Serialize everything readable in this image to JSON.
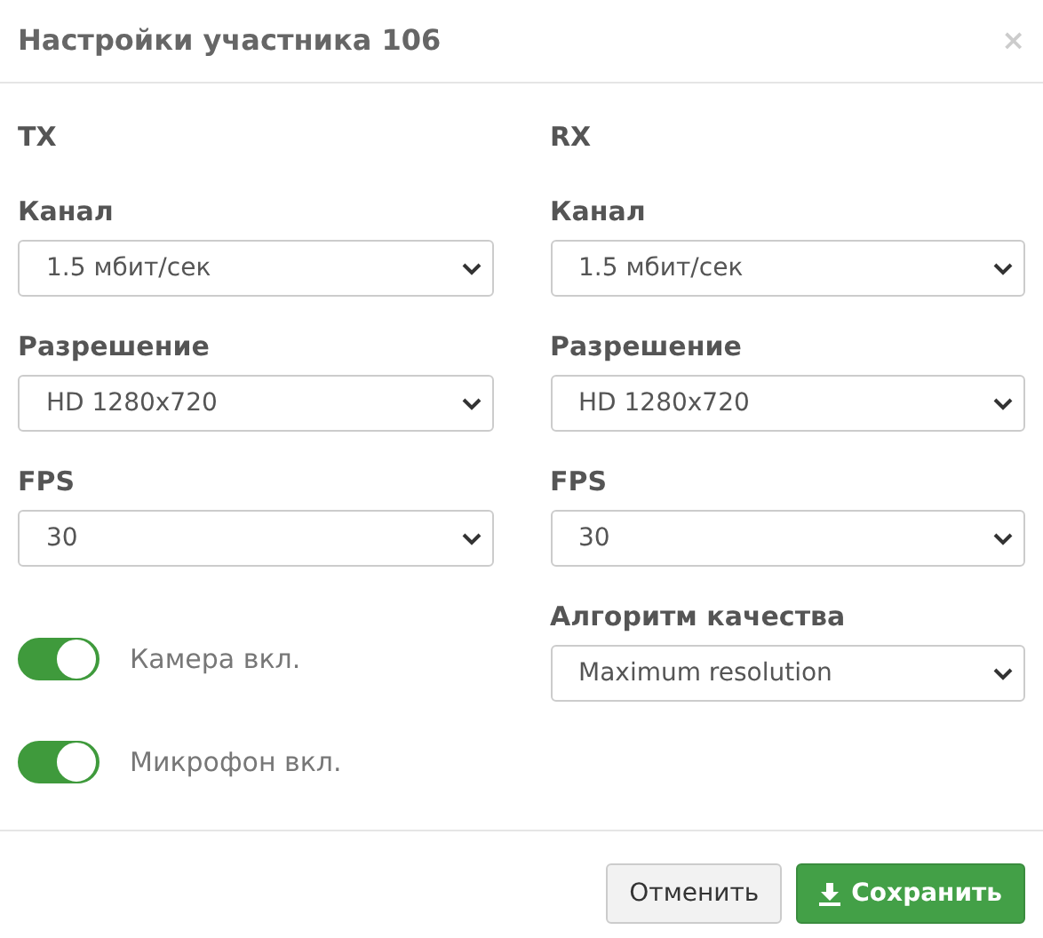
{
  "dialog": {
    "title": "Настройки участника 106",
    "close": "×"
  },
  "columns": [
    {
      "heading": "TX",
      "fields": [
        {
          "label": "Канал",
          "value": "1.5 мбит/сек"
        },
        {
          "label": "Разрешение",
          "value": "HD 1280x720"
        },
        {
          "label": "FPS",
          "value": "30"
        }
      ],
      "toggles": [
        {
          "label": "Камера вкл.",
          "on": true
        },
        {
          "label": "Микрофон вкл.",
          "on": true
        }
      ]
    },
    {
      "heading": "RX",
      "fields": [
        {
          "label": "Канал",
          "value": "1.5 мбит/сек"
        },
        {
          "label": "Разрешение",
          "value": "HD 1280x720"
        },
        {
          "label": "FPS",
          "value": "30"
        },
        {
          "label": "Алгоритм качества",
          "value": "Maximum resolution"
        }
      ]
    }
  ],
  "buttons": [
    {
      "label": "Отменить",
      "kind": "default"
    },
    {
      "label": "Сохранить",
      "kind": "primary"
    }
  ]
}
